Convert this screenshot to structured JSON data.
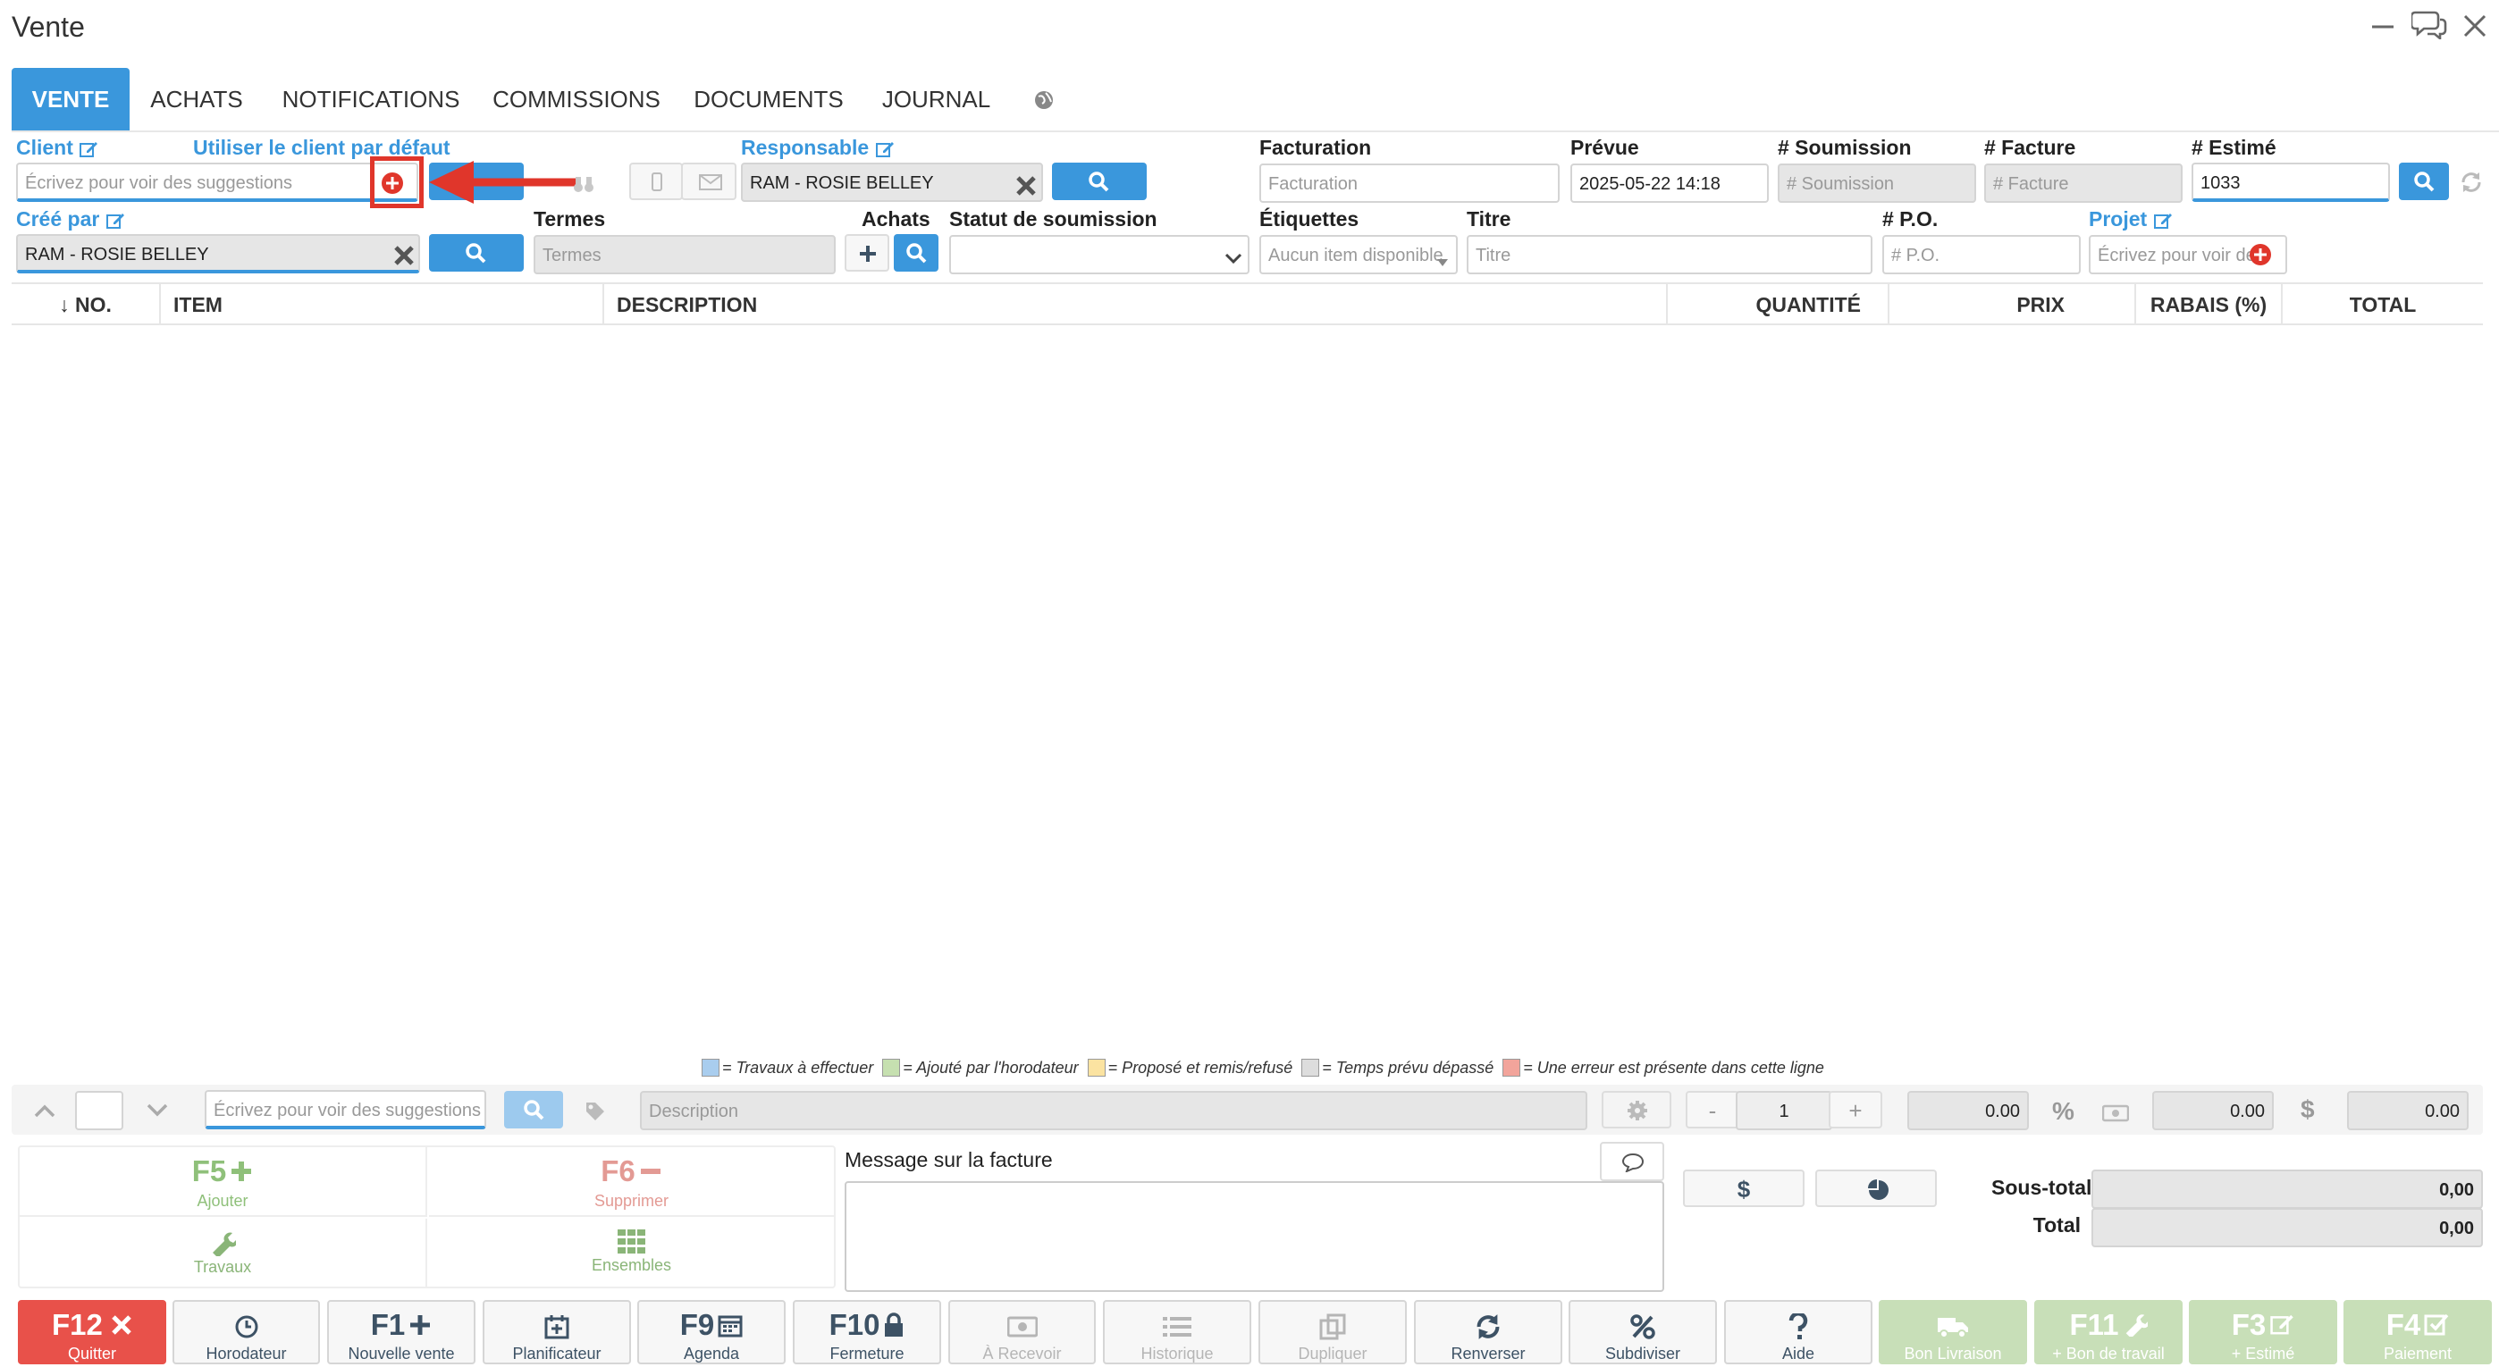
{
  "window": {
    "title": "Vente"
  },
  "tabs": [
    "VENTE",
    "ACHATS",
    "NOTIFICATIONS",
    "COMMISSIONS",
    "DOCUMENTS",
    "JOURNAL"
  ],
  "form": {
    "client_label": "Client",
    "default_client_link": "Utiliser le client par défaut",
    "client_placeholder": "Écrivez pour voir des suggestions",
    "responsable_label": "Responsable",
    "responsable_value": "RAM - ROSIE BELLEY",
    "facturation_label": "Facturation",
    "facturation_placeholder": "Facturation",
    "prevue_label": "Prévue",
    "prevue_value": "2025-05-22 14:18",
    "soumission_label": "# Soumission",
    "soumission_placeholder": "# Soumission",
    "facture_label": "# Facture",
    "facture_placeholder": "# Facture",
    "estime_label": "# Estimé",
    "estime_value": "1033",
    "cree_par_label": "Créé par",
    "cree_par_value": "RAM - ROSIE BELLEY",
    "termes_label": "Termes",
    "termes_placeholder": "Termes",
    "achats_label": "Achats",
    "statut_label": "Statut de soumission",
    "etiquettes_label": "Étiquettes",
    "etiquettes_placeholder": "Aucun item disponible",
    "titre_label": "Titre",
    "titre_placeholder": "Titre",
    "po_label": "# P.O.",
    "po_placeholder": "# P.O.",
    "projet_label": "Projet",
    "projet_placeholder": "Écrivez pour voir des"
  },
  "table": {
    "headers": [
      "↓ NO.",
      "ITEM",
      "DESCRIPTION",
      "QUANTITÉ",
      "PRIX",
      "RABAIS (%)",
      "TOTAL"
    ]
  },
  "legend": [
    {
      "color": "#a9cdee",
      "text": "= Travaux à effectuer"
    },
    {
      "color": "#c6e0b0",
      "text": "= Ajouté par l'horodateur"
    },
    {
      "color": "#fbe3a1",
      "text": "= Proposé et remis/refusé"
    },
    {
      "color": "#dddddd",
      "text": "= Temps prévu dépassé"
    },
    {
      "color": "#f2a49b",
      "text": "= Une erreur est présente dans cette ligne"
    }
  ],
  "line_entry": {
    "item_placeholder": "Écrivez pour voir des suggestions",
    "description_placeholder": "Description",
    "minus": "-",
    "quantity": "1",
    "plus": "+",
    "price": "0.00",
    "percent_symbol": "%",
    "discount": "0.00",
    "dollar_symbol": "$",
    "total": "0.00"
  },
  "actions": [
    {
      "key": "F5",
      "label": "Ajouter"
    },
    {
      "key": "F6",
      "label": "Supprimer"
    },
    {
      "label": "Travaux"
    },
    {
      "label": "Ensembles"
    }
  ],
  "message": {
    "label": "Message sur la facture"
  },
  "totals": {
    "dollar_symbol": "$",
    "subtotal_label": "Sous-total",
    "subtotal_value": "0,00",
    "total_label": "Total",
    "total_value": "0,00"
  },
  "footer": [
    {
      "key": "F12",
      "label": "Quitter"
    },
    {
      "key": "",
      "label": "Horodateur"
    },
    {
      "key": "F1",
      "label": "Nouvelle vente"
    },
    {
      "key": "",
      "label": "Planificateur"
    },
    {
      "key": "F9",
      "label": "Agenda"
    },
    {
      "key": "F10",
      "label": "Fermeture"
    },
    {
      "key": "",
      "label": "À Recevoir"
    },
    {
      "key": "",
      "label": "Historique"
    },
    {
      "key": "",
      "label": "Dupliquer"
    },
    {
      "key": "",
      "label": "Renverser"
    },
    {
      "key": "",
      "label": "Subdiviser"
    },
    {
      "key": "",
      "label": "Aide"
    },
    {
      "key": "",
      "label": "Bon Livraison"
    },
    {
      "key": "F11",
      "label": "+ Bon de travail"
    },
    {
      "key": "F3",
      "label": "+ Estimé"
    },
    {
      "key": "F4",
      "label": "Paiement"
    }
  ],
  "colors": {
    "accent": "#3a97dc",
    "danger": "#e8514a",
    "annotation": "#e0362b"
  }
}
